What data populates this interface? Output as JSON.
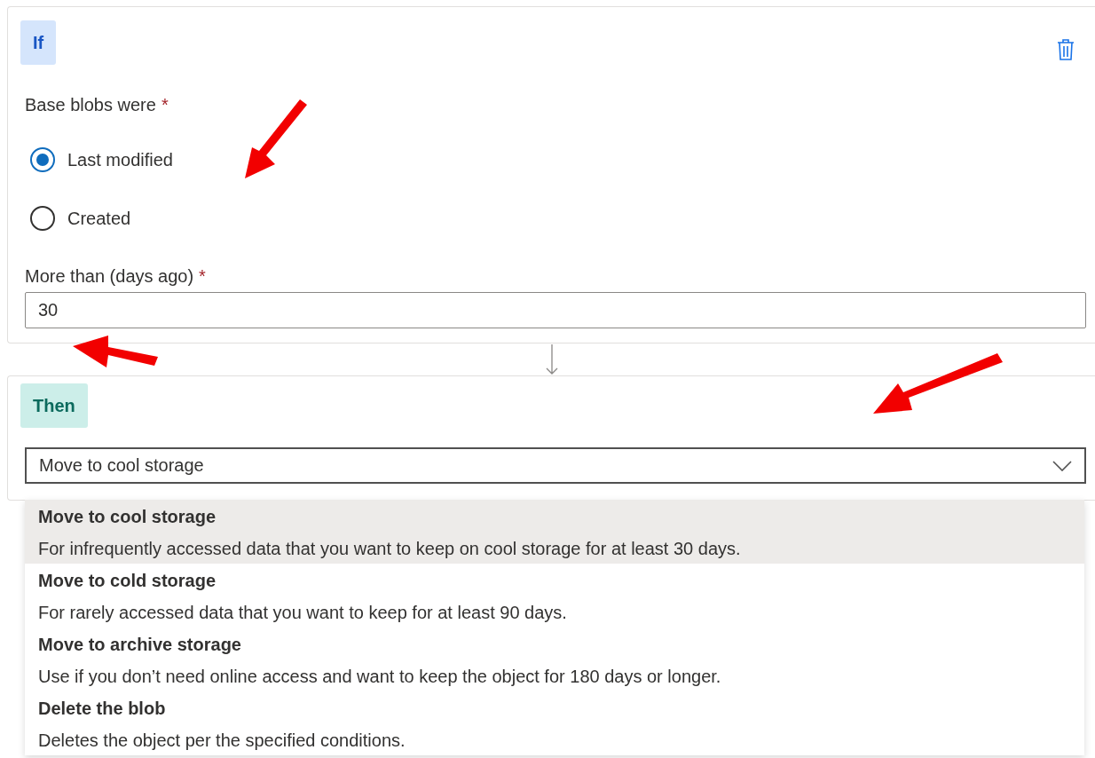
{
  "condition": {
    "badge": "If",
    "base_blobs": {
      "label": "Base blobs were",
      "required_mark": "*",
      "options": [
        {
          "label": "Last modified",
          "selected": true
        },
        {
          "label": "Created",
          "selected": false
        }
      ]
    },
    "days": {
      "label": "More than (days ago)",
      "required_mark": "*",
      "value": "30"
    }
  },
  "action": {
    "badge": "Then",
    "select": {
      "value": "Move to cool storage",
      "expanded": true
    },
    "options": [
      {
        "title": "Move to cool storage",
        "description": "For infrequently accessed data that you want to keep on cool storage for at least 30 days.",
        "selected": true
      },
      {
        "title": "Move to cold storage",
        "description": "For rarely accessed data that you want to keep for at least 90 days.",
        "selected": false
      },
      {
        "title": "Move to archive storage",
        "description": "Use if you don’t need online access and want to keep the object for 180 days or longer.",
        "selected": false
      },
      {
        "title": "Delete the blob",
        "description": "Deletes the object per the specified conditions.",
        "selected": false
      }
    ]
  }
}
